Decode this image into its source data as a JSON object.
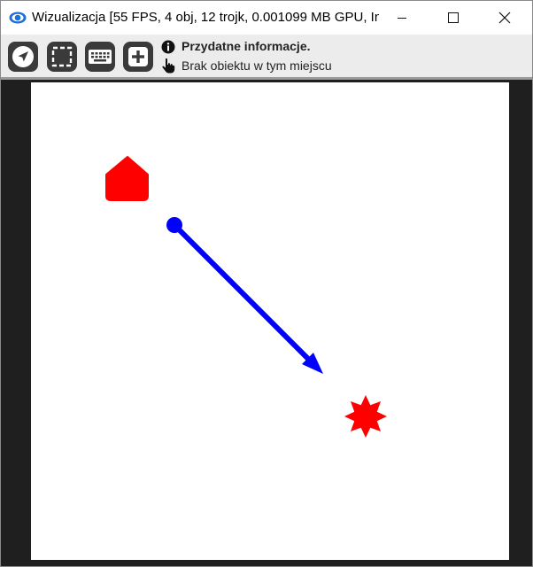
{
  "window": {
    "title": "Wizualizacja [55 FPS, 4 obj, 12 trojk, 0.001099 MB GPU, In...",
    "app_icon": "eye-icon"
  },
  "toolbar": {
    "buttons": [
      {
        "icon": "navigate-arrow-icon"
      },
      {
        "icon": "selection-frame-icon"
      },
      {
        "icon": "keyboard-icon"
      },
      {
        "icon": "plus-icon"
      }
    ],
    "info_title": "Przydatne informacje.",
    "info_status": "Brak obiektu w tym miejscu"
  },
  "scene": {
    "objects": [
      {
        "type": "house",
        "color": "#ff0000"
      },
      {
        "type": "arrow",
        "color": "#0000ff"
      },
      {
        "type": "star",
        "color": "#ff0000"
      }
    ]
  }
}
